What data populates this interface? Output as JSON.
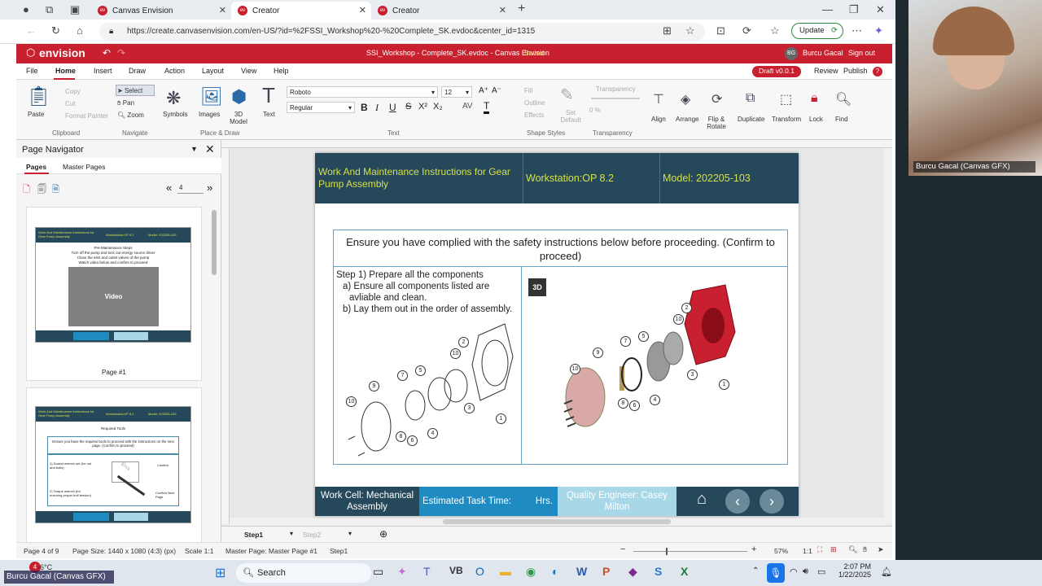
{
  "browser": {
    "tabs": [
      {
        "label": "Canvas Envision"
      },
      {
        "label": "Creator"
      },
      {
        "label": "Creator"
      }
    ],
    "url": "https://create.canvasenvision.com/en-US/?id=%2FSSI_Workshop%20-%20Complete_SK.evdoc&center_id=1315",
    "update_label": "Update"
  },
  "app": {
    "logo": "envision",
    "doc_title": "SSI_Workshop - Complete_SK.evdoc - Canvas Envision",
    "saved": "Saved",
    "user_initials": "BG",
    "user_name": "Burcu Gacal",
    "sign_out": "Sign out",
    "menu": [
      "File",
      "Home",
      "Insert",
      "Draw",
      "Action",
      "Layout",
      "View",
      "Help"
    ],
    "draft": "Draft v0.0.1",
    "review": "Review",
    "publish": "Publish"
  },
  "ribbon": {
    "clipboard": {
      "paste": "Paste",
      "copy": "Copy",
      "cut": "Cut",
      "format_painter": "Format Painter",
      "group": "Clipboard"
    },
    "navigate": {
      "select": "Select",
      "pan": "Pan",
      "zoom": "Zoom",
      "group": "Navigate"
    },
    "place": {
      "symbols": "Symbols",
      "images": "Images",
      "model3d": "3D Model",
      "text": "Text",
      "group": "Place & Draw"
    },
    "text": {
      "font": "Roboto",
      "size": "12",
      "weight": "Regular",
      "group": "Text"
    },
    "shape": {
      "fill": "Fill",
      "outline": "Outline",
      "effects": "Effects",
      "set_default": "Set Default",
      "group": "Shape Styles"
    },
    "transparency": {
      "label": "Transparency",
      "value": "0 %",
      "group": "Transparency"
    },
    "tools": [
      "Align",
      "Arrange",
      "Flip & Rotate",
      "Duplicate",
      "Transform",
      "Lock",
      "Find"
    ]
  },
  "navigator": {
    "title": "Page Navigator",
    "tabs": [
      "Pages",
      "Master Pages"
    ],
    "page_input": "4",
    "thumb1": {
      "title": "Work And Maintenance Instructions for Gear Pump Assembly",
      "ws": "Workstation:OP 8.2",
      "model": "Model: 202205-103",
      "heading": "Pre-Maintenance Steps",
      "lines": [
        "Turn off the pump and lock out energy source driver",
        "Close the inlet and outlet valves of the pump",
        "Watch video below and confirm to proceed"
      ],
      "video": "Video",
      "caption": "Page #1"
    },
    "thumb2": {
      "heading": "Required Tools",
      "confirm": "Ensure you have the required tools to proceed with the instructions on the next page. (Confirm to proceed)",
      "tool1": "1) Socket wrench set (for nut and bolts)",
      "tool2": "2) Torque wrench (for ensuring proper bolt tension)",
      "confirm_btn": "Confirm",
      "next_btn": "Confirm Next Page"
    }
  },
  "slide": {
    "header": {
      "title": "Work And Maintenance Instructions for Gear Pump Assembly",
      "workstation": "Workstation:OP 8.2",
      "model": "Model: 202205-103"
    },
    "safety": "Ensure you have complied with the safety instructions below before proceeding. (Confirm to proceed)",
    "step_title": "Step 1)   Prepare all the components",
    "step_a": "a) Ensure all components listed are",
    "step_a2": "avliable and clean.",
    "step_b": "b) Lay them out in the order of assembly.",
    "badge_3d": "3D",
    "callouts": [
      "10",
      "9",
      "7",
      "5",
      "2",
      "10",
      "3",
      "1",
      "4",
      "6",
      "8"
    ],
    "callouts3d": [
      "10",
      "9",
      "7",
      "5",
      "2",
      "10",
      "3",
      "1",
      "4",
      "6",
      "8"
    ],
    "footer": {
      "work_cell": "Work Cell: Mechanical Assembly",
      "task_time": "Estimated Task Time:",
      "hrs": "Hrs.",
      "quality": "Quality Engineer: Casey Milton"
    }
  },
  "canvas_tabs": {
    "step1": "Step1",
    "step2": "Step2"
  },
  "status": {
    "page": "Page 4 of 9",
    "size": "Page Size: 1440 x 1080 (4:3) (px)",
    "scale": "Scale 1:1",
    "master": "Master Page: Master Page #1",
    "step": "Step1",
    "zoom": "57%",
    "ratio": "1:1"
  },
  "taskbar": {
    "search": "Search",
    "time": "2:07 PM",
    "date": "1/22/2025",
    "temp": "-6°C",
    "badge": "4"
  },
  "webcam": {
    "name": "Burcu Gacal (Canvas GFX)"
  },
  "overlay_name": "Burcu Gacal (Canvas GFX)"
}
